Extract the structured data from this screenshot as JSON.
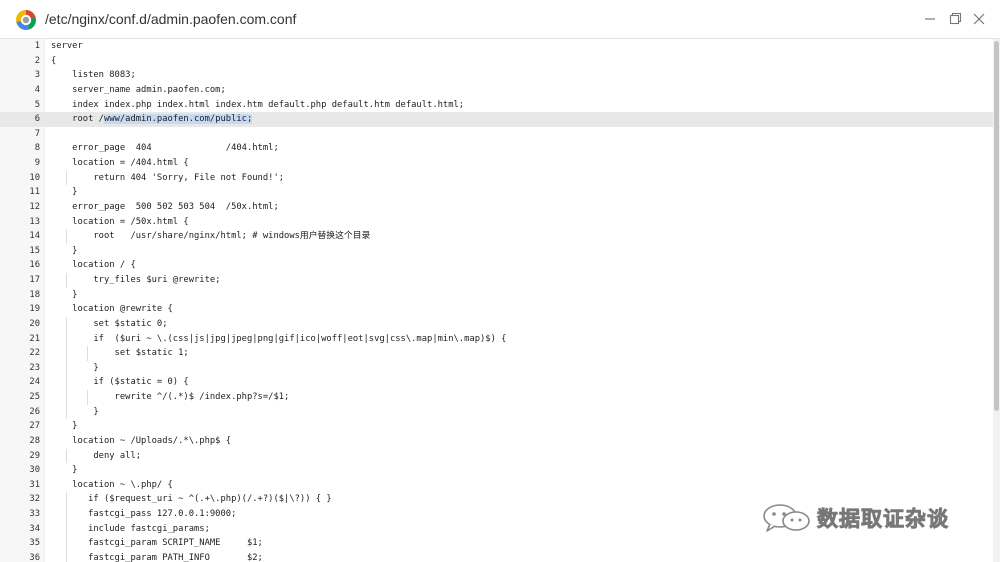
{
  "window": {
    "title": "/etc/nginx/conf.d/admin.paofen.com.conf"
  },
  "editor": {
    "current_line": 6,
    "lines": [
      {
        "n": "1",
        "text": "server"
      },
      {
        "n": "2",
        "text": "{"
      },
      {
        "n": "3",
        "text": "    listen 8083;"
      },
      {
        "n": "4",
        "text": "    server_name admin.paofen.com;"
      },
      {
        "n": "5",
        "text": "    index index.php index.html index.htm default.php default.htm default.html;"
      },
      {
        "n": "6",
        "pre": "    root /",
        "sel": "www/admin.paofen.com/public;",
        "text": ""
      },
      {
        "n": "7",
        "text": ""
      },
      {
        "n": "8",
        "text": "    error_page  404              /404.html;"
      },
      {
        "n": "9",
        "text": "    location = /404.html {"
      },
      {
        "n": "10",
        "text": "        return 404 'Sorry, File not Found!';"
      },
      {
        "n": "11",
        "text": "    }"
      },
      {
        "n": "12",
        "text": "    error_page  500 502 503 504  /50x.html;"
      },
      {
        "n": "13",
        "text": "    location = /50x.html {"
      },
      {
        "n": "14",
        "text": "        root   /usr/share/nginx/html; # windows用户替换这个目录"
      },
      {
        "n": "15",
        "text": "    }"
      },
      {
        "n": "16",
        "text": "    location / {"
      },
      {
        "n": "17",
        "text": "        try_files $uri @rewrite;"
      },
      {
        "n": "18",
        "text": "    }"
      },
      {
        "n": "19",
        "text": "    location @rewrite {"
      },
      {
        "n": "20",
        "text": "        set $static 0;"
      },
      {
        "n": "21",
        "text": "        if  ($uri ~ \\.(css|js|jpg|jpeg|png|gif|ico|woff|eot|svg|css\\.map|min\\.map)$) {"
      },
      {
        "n": "22",
        "text": "            set $static 1;"
      },
      {
        "n": "23",
        "text": "        }"
      },
      {
        "n": "24",
        "text": "        if ($static = 0) {"
      },
      {
        "n": "25",
        "text": "            rewrite ^/(.*)$ /index.php?s=/$1;"
      },
      {
        "n": "26",
        "text": "        }"
      },
      {
        "n": "27",
        "text": "    }"
      },
      {
        "n": "28",
        "text": "    location ~ /Uploads/.*\\.php$ {"
      },
      {
        "n": "29",
        "text": "        deny all;"
      },
      {
        "n": "30",
        "text": "    }"
      },
      {
        "n": "31",
        "text": "    location ~ \\.php/ {"
      },
      {
        "n": "32",
        "text": "       if ($request_uri ~ ^(.+\\.php)(/.+?)($|\\?)) { }"
      },
      {
        "n": "33",
        "text": "       fastcgi_pass 127.0.0.1:9000;"
      },
      {
        "n": "34",
        "text": "       include fastcgi_params;"
      },
      {
        "n": "35",
        "text": "       fastcgi_param SCRIPT_NAME     $1;"
      },
      {
        "n": "36",
        "text": "       fastcgi_param PATH_INFO       $2;"
      }
    ]
  },
  "watermark": {
    "text": "数据取证杂谈",
    "icon": "wechat-official-account-icon"
  },
  "colors": {
    "selection": "#c5d9f5",
    "current_line": "#e8e8e8",
    "gutter": "#f7f7f7"
  }
}
